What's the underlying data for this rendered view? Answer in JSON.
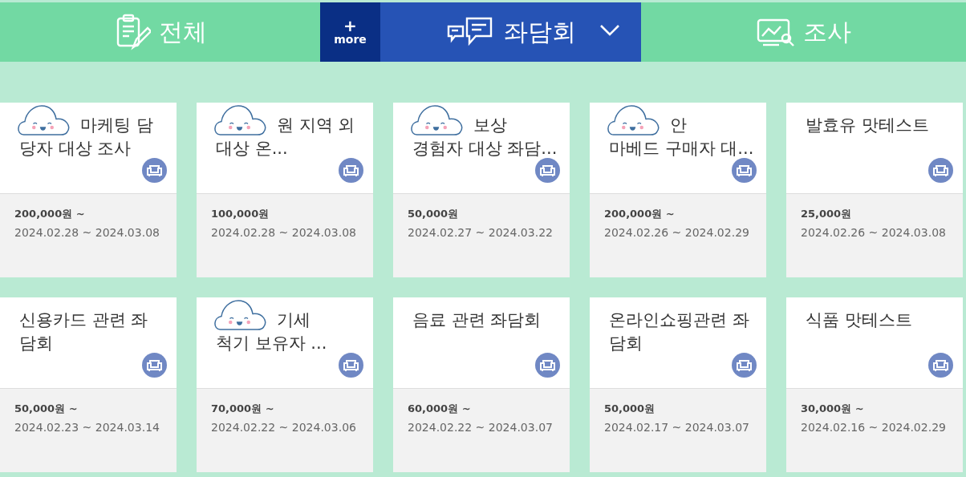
{
  "tabs": [
    {
      "kind": "tab",
      "label": "전체",
      "selected": false
    },
    {
      "kind": "more",
      "plus": "+",
      "label": "more",
      "selected": false
    },
    {
      "kind": "tab",
      "label": "좌담회",
      "selected": true,
      "dropdown": true
    },
    {
      "kind": "tab",
      "label": "조사",
      "selected": false
    }
  ],
  "cards": [
    {
      "cloud": true,
      "lines": [
        "마케팅 담",
        "당자 대상 조사"
      ],
      "price": "200,000원 ~",
      "period": "2024.02.28 ~ 2024.03.08"
    },
    {
      "cloud": true,
      "lines": [
        "원 지역 외",
        "대상 온..."
      ],
      "price": "100,000원",
      "period": "2024.02.28 ~ 2024.03.08"
    },
    {
      "cloud": true,
      "lines": [
        "보상",
        "경험자 대상 좌담..."
      ],
      "price": "50,000원",
      "period": "2024.02.27 ~ 2024.03.22"
    },
    {
      "cloud": true,
      "lines": [
        "안",
        "마베드 구매자 대..."
      ],
      "price": "200,000원 ~",
      "period": "2024.02.26 ~ 2024.02.29"
    },
    {
      "cloud": false,
      "lines": [
        "발효유 맛테스트"
      ],
      "price": "25,000원",
      "period": "2024.02.26 ~ 2024.03.08"
    },
    {
      "cloud": false,
      "lines": [
        "신용카드 관련 좌",
        "담회"
      ],
      "price": "50,000원 ~",
      "period": "2024.02.23 ~ 2024.03.14"
    },
    {
      "cloud": true,
      "lines": [
        "기세",
        "척기 보유자 ..."
      ],
      "price": "70,000원 ~",
      "period": "2024.02.22 ~ 2024.03.06"
    },
    {
      "cloud": false,
      "lines": [
        "음료 관련 좌담회"
      ],
      "price": "60,000원 ~",
      "period": "2024.02.22 ~ 2024.03.07"
    },
    {
      "cloud": false,
      "lines": [
        "온라인쇼핑관련 좌",
        "담회"
      ],
      "price": "50,000원",
      "period": "2024.02.17 ~ 2024.03.07"
    },
    {
      "cloud": false,
      "lines": [
        "식품 맛테스트"
      ],
      "price": "30,000원 ~",
      "period": "2024.02.16 ~ 2024.02.29"
    }
  ]
}
